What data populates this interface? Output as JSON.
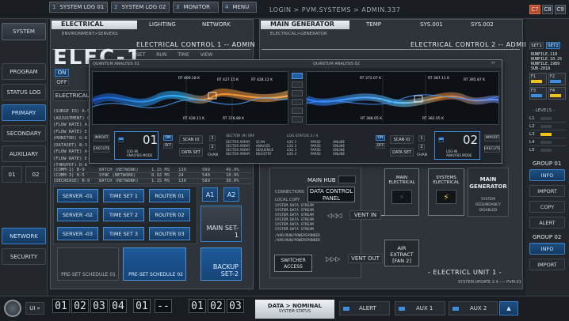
{
  "top_bar": {
    "tabs": [
      {
        "num": "1",
        "label": "SYSTEM LOG 01"
      },
      {
        "num": "2",
        "label": "SYSTEM LOG 02"
      },
      {
        "num": "3",
        "label": "MONITOR"
      },
      {
        "num": "4",
        "label": "MENU"
      }
    ],
    "login_path": "LOGIN > PVM.SYSTEMS > ADMIN.337",
    "codes": [
      "C7",
      "C8",
      "C9"
    ]
  },
  "sidebar": {
    "items": [
      "SYSTEM",
      "PROGRAM",
      "STATUS LOG",
      "PRIMARY",
      "SECONDARY",
      "AUXILIARY",
      "01",
      "02",
      "NETWORK",
      "SECURITY"
    ]
  },
  "left_panel": {
    "tab_electrical": "ELECTRICAL",
    "tab_lighting": "LIGHTING",
    "tab_network": "NETWORK",
    "breadcrumb": "ENVIRONMENT>SERVERS",
    "control_title": "ELECTRICAL CONTROL 1 -- ADMIN",
    "big_text": "ELEC-1",
    "header_items": [
      "SET",
      "RUN",
      "TIME",
      "VIEW"
    ],
    "on_label": "ON",
    "off_label": "OFF",
    "electrical_label": "ELECTRICAL",
    "log_lines": [
      "(SURGE IO) A-5",
      "(ADJUSTMENT) C",
      "(FLOW RATE) A-",
      "(FLOW RATE) E-",
      "(MONITOR) G-8",
      "(DATASET) B-3",
      "(FLOW RATE) A-",
      "(FLOW RATE) E-",
      "(THRUPUT) D-8"
    ],
    "table_rows": [
      {
        "key": "(COMM-1) B-9",
        "name": "BATCH (NETWORK)",
        "v1": "1.15 MS",
        "v2": "130",
        "v3": "999",
        "v4": "49.9%"
      },
      {
        "key": "(COMM-3) H-5",
        "name": "SYNC (NETWORK)",
        "v1": "8.92 MS",
        "v2": "24",
        "v3": "540",
        "v4": "10.9%"
      },
      {
        "key": "(DECREASE) B-9",
        "name": "BATCH (NETWORK)",
        "v1": "1.15 MS",
        "v2": "130",
        "v3": "589",
        "v4": "30.0%"
      }
    ],
    "tiles": [
      [
        "SERVER -01",
        "TIME SET 1",
        "ROUTER 01"
      ],
      [
        "SERVER -02",
        "TIME SET 2",
        "ROUTER 02"
      ],
      [
        "SERVER -03",
        "TIME SET 3",
        "ROUTER 03"
      ]
    ],
    "a1": "A1",
    "a2": "A2",
    "main_set": "MAIN SET-1",
    "preset_1": "PRE-SET SCHEDULE 01",
    "preset_2": "PRE-SET SCHEDULE 02",
    "backup_set": "BACKUP SET-2"
  },
  "right_panel": {
    "title": "MAIN GENERATOR",
    "tab_temp": "TEMP",
    "tab_sys1": "SYS.001",
    "tab_sys2": "SYS.002",
    "breadcrumb": "ELECTRICAL>GENERATOR",
    "control_title": "ELECTRICAL CONTROL 2 -- ADMIN",
    "main_hub": "MAIN HUB",
    "data_panel": "DATA CONTROL PANEL",
    "connections_label": "CONNECTIONS",
    "local_copy": "LOCAL COPY",
    "streams": [
      "SYSTEM.DATA STREAM",
      "SYSTEM.DATA STREAM",
      "SYSTEM.DATA STREAM",
      "SYSTEM.DATA STREAM",
      "SYSTEM.DATA STREAM",
      "SYSTEM.DATA STREAM"
    ],
    "paths": [
      "/VAR/RUN/POWERSPONDER",
      "/VAR/RUN/POWERSPONDER"
    ],
    "switcher": "SWITCHER ACCESS",
    "vent_in": "VENT IN",
    "vent_out": "VENT OUT",
    "main_electrical": "MAIN ELECTRICAL",
    "systems_electrical": "SYSTEMS ELECTRICAL",
    "main_generator_box": "MAIN GENERATOR",
    "redundancy": "SYSTEM REDUNDANCY DISABLED",
    "air_extract": "AIR EXTRACT [FAN 2]",
    "unit_label": "- ELECTRICL UNIT 1 -",
    "status_line": "SYSTEM.UPDATE 2.4 ---- PVM.01"
  },
  "quantum_window": {
    "left_title": "QUANTUM ANALYSIS 01",
    "right_title": "QUANTUM ANALYSIS 02",
    "chart_tags_left": [
      "RT 409.18 K",
      "RT 427.15 K",
      "RT 428.12 K",
      "RT 428.11 K",
      "RT 378.88 K"
    ],
    "chart_tags_right": [
      "RT 372.07 K",
      "RT 387.11 K",
      "RT 395.87 K",
      "RT 388.05 K",
      "RT 382.05 K"
    ],
    "import": "IMPORT",
    "execute": "EXECUTE",
    "big_num_1": "01",
    "big_num_2": "02",
    "mode_label": "LOG-IN ANALYSIS MODE",
    "scan_io": "SCAN IO",
    "data_set": "DATA SET",
    "chan": "CHAN",
    "on": "ON",
    "off": "OFF",
    "section_label": "SECTOR (R) SRF",
    "list_left": [
      "SECTOR ARRAY",
      "SECTOR ARRAY",
      "SECTOR ARRAY",
      "SECTOR ARRAY"
    ],
    "list_left_vals": [
      "SCAN",
      "ANALYZE",
      "SEQUENCE",
      "REGISTRY"
    ],
    "log_header": "LOG.STATUS 3 / 4",
    "log_items": [
      "LOG 1",
      "LOG 2",
      "LOG 3",
      "LOG 4"
    ],
    "log_vals": [
      "PARSE",
      "PARSE",
      "PARSE",
      "PARSE"
    ],
    "log_status": [
      "ONLINE",
      "ONLINE",
      "ONLINE",
      "ONLINE"
    ]
  },
  "right_column": {
    "set1": "SET1",
    "set2": "SET2",
    "runfile_lines": [
      "RUNFILE.118",
      "RUNFILE.10.25",
      "RUNFILE.1989",
      "SUB-2018"
    ],
    "f_labels": [
      "F1",
      "F2",
      "F3",
      "F4"
    ],
    "levels_label": "- LEVELS -",
    "levels": [
      "L1",
      "L2",
      "L3",
      "L4",
      "L5"
    ],
    "group1": "GROUP 01",
    "group2": "GROUP 02",
    "info": "INFO",
    "import": "IMPORT",
    "copy": "COPY",
    "alert": "ALERT"
  },
  "bottom_bar": {
    "ui_label": "UI",
    "digits_left": [
      "01",
      "02",
      "03",
      "04",
      "01",
      "--"
    ],
    "digits_right": [
      "01",
      "02",
      "03"
    ],
    "status_main": "DATA > NOMINAL",
    "status_sub": "SYSTEM STATUS",
    "alert": "ALERT",
    "aux1": "AUX 1",
    "aux2": "AUX 2"
  }
}
